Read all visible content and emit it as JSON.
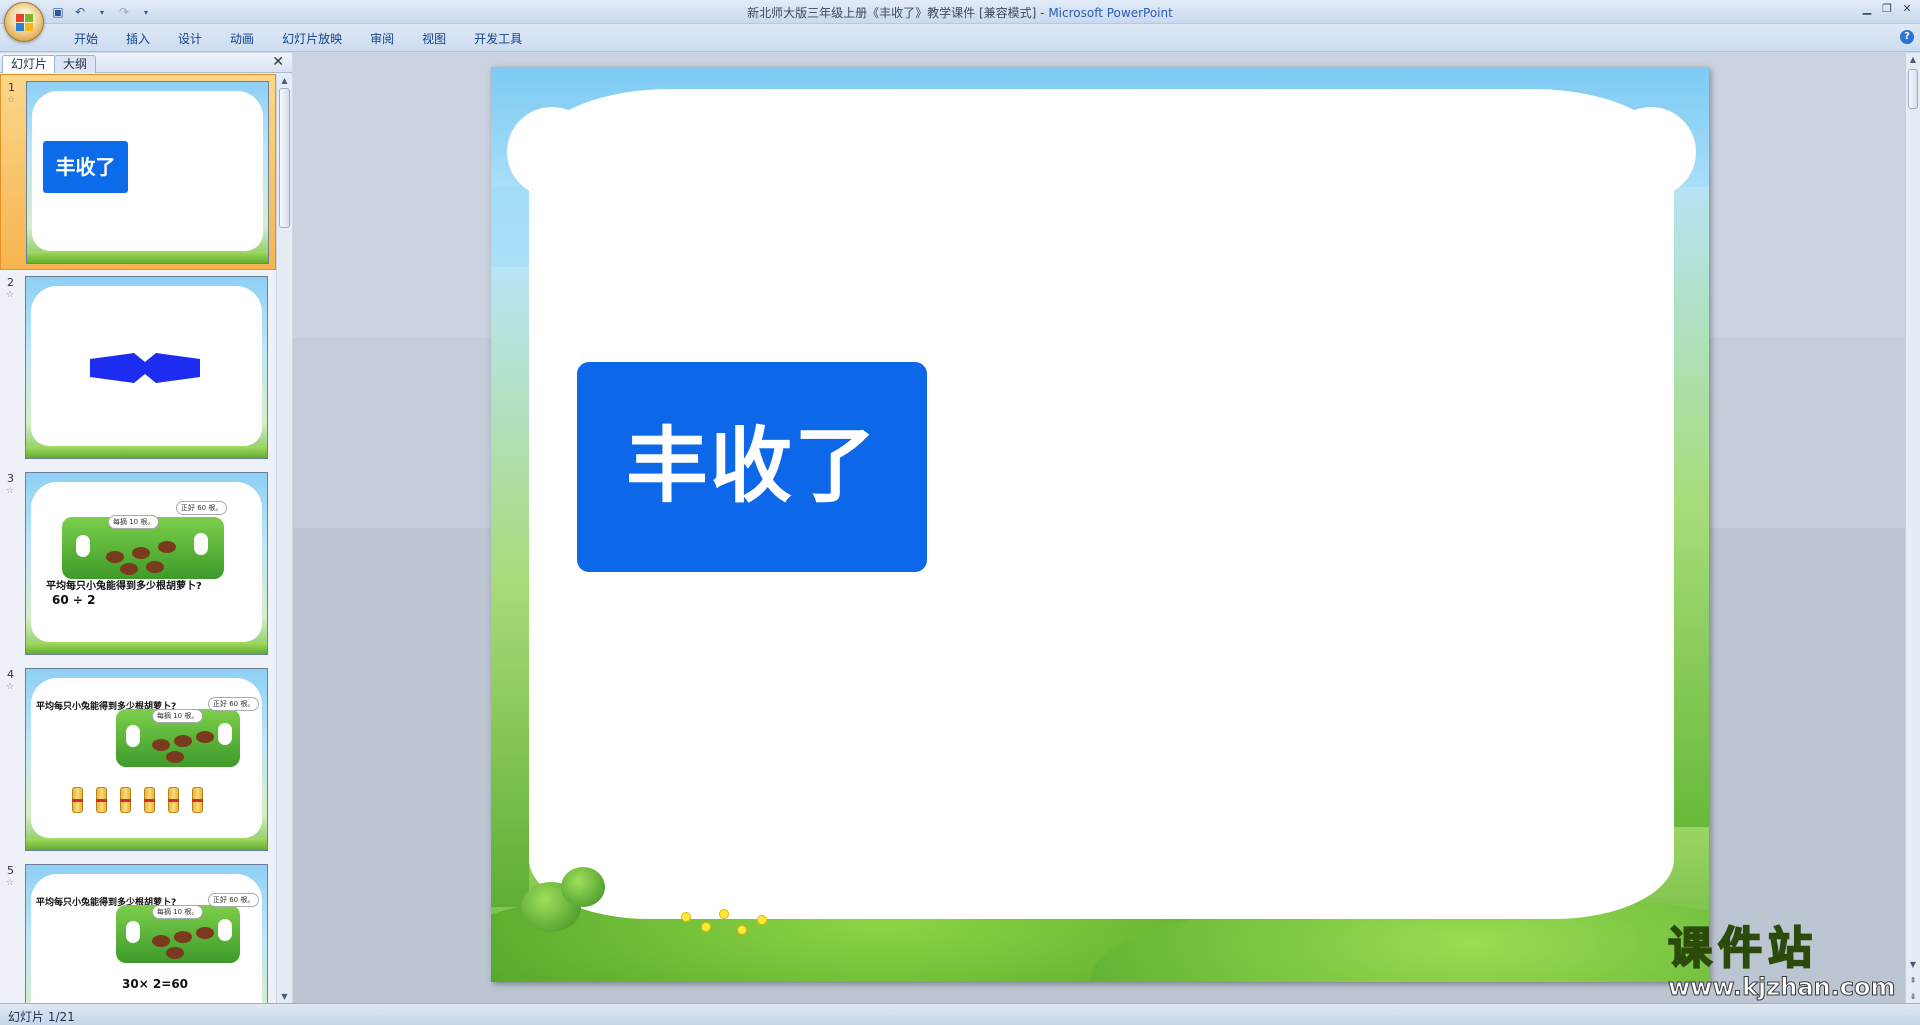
{
  "window": {
    "title_doc": "新北师大版三年级上册《丰收了》教学课件 [兼容模式] - ",
    "title_app": "Microsoft PowerPoint"
  },
  "ribbon": {
    "tabs": [
      "开始",
      "插入",
      "设计",
      "动画",
      "幻灯片放映",
      "审阅",
      "视图",
      "开发工具"
    ]
  },
  "left_pane": {
    "tab_slides": "幻灯片",
    "tab_outline": "大纲",
    "close": "✕",
    "thumbnails": [
      {
        "num": "1",
        "title": "丰收了",
        "selected": true
      },
      {
        "num": "2"
      },
      {
        "num": "3",
        "bubble_a": "每摘 10 根。",
        "bubble_b": "正好 60 根。",
        "question": "平均每只小兔能得到多少根胡萝卜?",
        "equation": "60 ÷ 2"
      },
      {
        "num": "4",
        "question": "平均每只小兔能得到多少根胡萝卜?",
        "bubble_a": "每摘 10 根。",
        "bubble_b": "正好 60 根。"
      },
      {
        "num": "5",
        "question": "平均每只小兔能得到多少根胡萝卜?",
        "bubble_a": "每摘 10 根。",
        "bubble_b": "正好 60 根。",
        "equation": "30× 2=60"
      }
    ]
  },
  "slide": {
    "title": "丰收了",
    "accent_color": "#0c67e9"
  },
  "watermark": {
    "cn": "课件站",
    "url": "www.kjzhan.com"
  },
  "status": {
    "slide_counter": "幻灯片 1/21"
  }
}
